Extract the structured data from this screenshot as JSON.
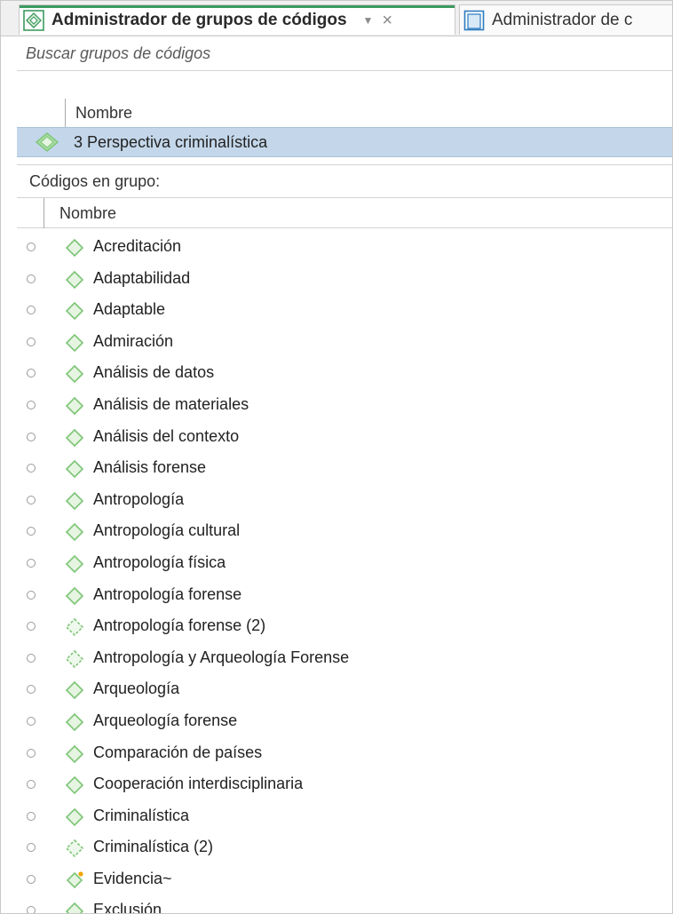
{
  "tabs": [
    {
      "title": "Administrador de grupos de códigos",
      "active": true,
      "dropdown_icon": "chevron-down-icon",
      "close_icon": "close-icon"
    },
    {
      "title": "Administrador de c",
      "active": false
    }
  ],
  "search": {
    "placeholder": "Buscar grupos de códigos",
    "value": ""
  },
  "groups": {
    "column_header": "Nombre",
    "items": [
      {
        "label": "3 Perspectiva criminalística",
        "selected": true,
        "icon": "code-group-icon"
      }
    ]
  },
  "codes": {
    "section_label": "Códigos en grupo:",
    "column_header": "Nombre",
    "items": [
      {
        "label": "Acreditación",
        "icon": "code-diamond-icon"
      },
      {
        "label": "Adaptabilidad",
        "icon": "code-diamond-icon"
      },
      {
        "label": "Adaptable",
        "icon": "code-diamond-icon"
      },
      {
        "label": "Admiración",
        "icon": "code-diamond-icon"
      },
      {
        "label": "Análisis de datos",
        "icon": "code-diamond-icon"
      },
      {
        "label": "Análisis de materiales",
        "icon": "code-diamond-icon"
      },
      {
        "label": "Análisis del contexto",
        "icon": "code-diamond-icon"
      },
      {
        "label": "Análisis forense",
        "icon": "code-diamond-icon"
      },
      {
        "label": "Antropología",
        "icon": "code-diamond-icon"
      },
      {
        "label": "Antropología cultural",
        "icon": "code-diamond-icon"
      },
      {
        "label": "Antropología física",
        "icon": "code-diamond-icon"
      },
      {
        "label": "Antropología forense",
        "icon": "code-diamond-icon"
      },
      {
        "label": "Antropología forense (2)",
        "icon": "code-dashed-diamond-icon"
      },
      {
        "label": "Antropología y Arqueología Forense",
        "icon": "code-dashed-diamond-icon"
      },
      {
        "label": "Arqueología",
        "icon": "code-diamond-icon"
      },
      {
        "label": "Arqueología forense",
        "icon": "code-diamond-icon"
      },
      {
        "label": "Comparación de países",
        "icon": "code-diamond-icon"
      },
      {
        "label": "Cooperación interdisciplinaria",
        "icon": "code-diamond-icon"
      },
      {
        "label": "Criminalística",
        "icon": "code-diamond-icon"
      },
      {
        "label": "Criminalística (2)",
        "icon": "code-dashed-diamond-icon"
      },
      {
        "label": "Evidencia~",
        "icon": "code-diamond-star-icon"
      },
      {
        "label": "Exclusión",
        "icon": "code-diamond-icon"
      }
    ]
  },
  "colors": {
    "code_green": "#7cc576",
    "code_green_fill": "#e6f4e2",
    "selection": "#c4d7ea",
    "star": "#f0a500"
  }
}
